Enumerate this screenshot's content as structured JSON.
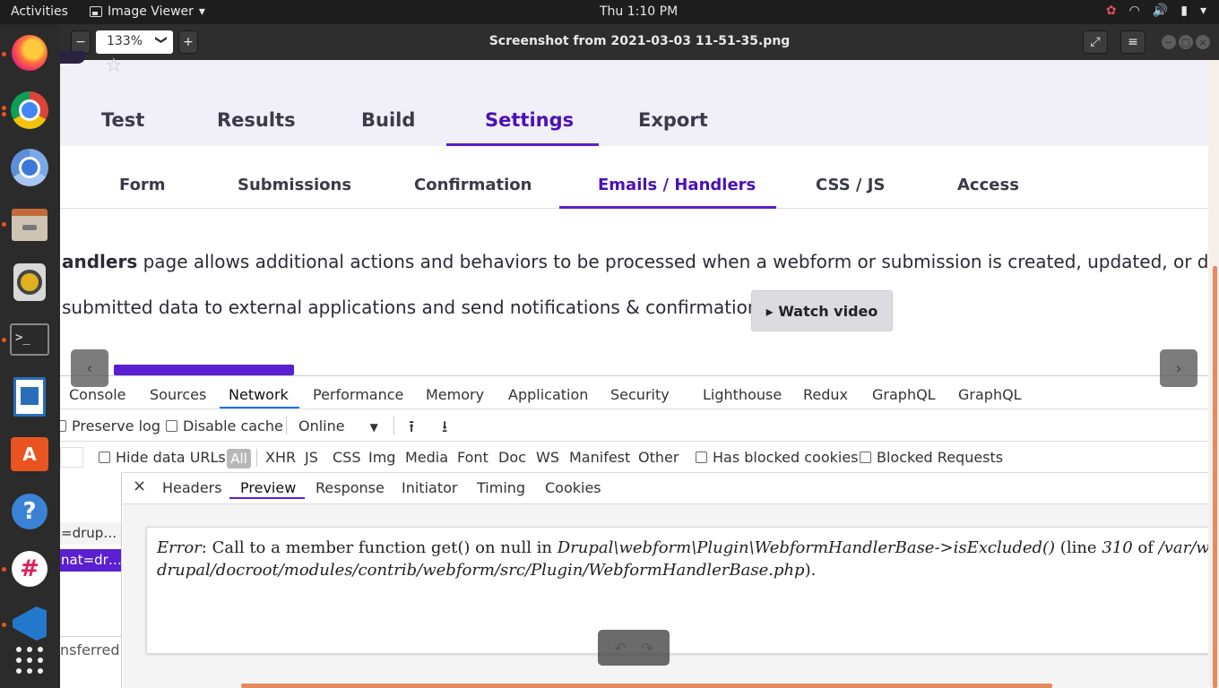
{
  "topbar": {
    "activities": "Activities",
    "app_name": "Image Viewer",
    "app_menu_arrow": "▾",
    "clock": "Thu  1:10 PM",
    "tray": {
      "slack": "✿",
      "wifi": "◠",
      "volume": "🔊",
      "battery": "▮",
      "menu": "▾"
    }
  },
  "dock": {
    "items": [
      {
        "name": "firefox"
      },
      {
        "name": "chrome"
      },
      {
        "name": "chromium"
      },
      {
        "name": "files"
      },
      {
        "name": "rhythmbox"
      },
      {
        "name": "terminal",
        "glyph": ">_"
      },
      {
        "name": "writer"
      },
      {
        "name": "software",
        "glyph": "A"
      },
      {
        "name": "help",
        "glyph": "?"
      },
      {
        "name": "slack",
        "glyph": "#"
      },
      {
        "name": "vscode"
      },
      {
        "name": "show-apps"
      }
    ]
  },
  "viewer": {
    "zoom_out": "−",
    "zoom_value": "133%",
    "zoom_chevron": "❯",
    "zoom_in": "+",
    "title": "Screenshot from 2021-03-03 11-51-35.png",
    "fullscreen": "⤢",
    "menu": "≡",
    "minimize": "−",
    "maximize": "□",
    "close": "×",
    "prev": "‹",
    "next": "›",
    "rotate_left": "↶",
    "rotate_right": "↷"
  },
  "page": {
    "star": "☆",
    "primary_tabs": [
      "Test",
      "Results",
      "Build",
      "Settings",
      "Export"
    ],
    "secondary_tabs": [
      "Form",
      "Submissions",
      "Confirmation",
      "Emails / Handlers",
      "CSS / JS",
      "Access"
    ],
    "desc_line1_bold": "andlers",
    "desc_line1_rest": " page allows additional actions and behaviors to be processed when a webform or submission is created, updated, or deleted.",
    "desc_line2": " submitted data to external applications and send notifications & confirmations.",
    "watch_video": "▸ Watch video"
  },
  "devtools": {
    "tabs": [
      "Console",
      "Sources",
      "Network",
      "Performance",
      "Memory",
      "Application",
      "Security",
      "Lighthouse",
      "Redux",
      "GraphQL",
      "GraphQL"
    ],
    "toolbar": {
      "preserve_log": "Preserve log",
      "disable_cache": "Disable cache",
      "throttle": "Online",
      "throttle_arrow": "▼",
      "upload": "⭱",
      "download": "⭳"
    },
    "filters": {
      "hide_data_urls": "Hide data URLs",
      "all": "All",
      "types": [
        "XHR",
        "JS",
        "CSS",
        "Img",
        "Media",
        "Font",
        "Doc",
        "WS",
        "Manifest",
        "Other"
      ],
      "has_blocked_cookies": "Has blocked cookies",
      "blocked_requests": "Blocked Requests"
    },
    "requests": [
      "=drup…",
      "nat=dr…"
    ],
    "status": "nsferred",
    "detail_close": "×",
    "detail_tabs": [
      "Headers",
      "Preview",
      "Response",
      "Initiator",
      "Timing",
      "Cookies"
    ],
    "error": {
      "label": "Error",
      "text1": ": Call to a member function get() on null in ",
      "func": "Drupal\\webform\\Plugin\\WebformHandlerBase->isExcluded()",
      "text2": " (line ",
      "line_no": "310",
      "text3": " of ",
      "path1": "/var/www/htm",
      "path2": "drupal/docroot/modules/contrib/webform/src/Plugin/WebformHandlerBase.php",
      "text4": ")."
    }
  }
}
